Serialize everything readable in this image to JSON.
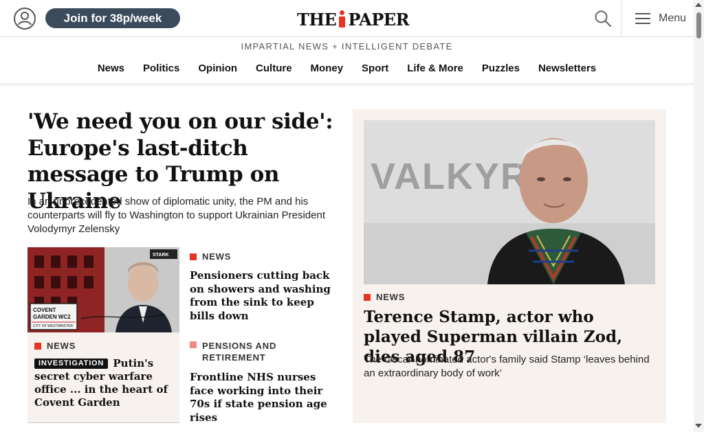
{
  "header": {
    "join_label": "Join for 38p/week",
    "logo_left": "THE",
    "logo_right": "PAPER",
    "menu_label": "Menu",
    "tagline": "IMPARTIAL NEWS + INTELLIGENT DEBATE"
  },
  "nav": [
    "News",
    "Politics",
    "Opinion",
    "Culture",
    "Money",
    "Sport",
    "Life & More",
    "Puzzles",
    "Newsletters"
  ],
  "lead": {
    "headline": "'We need you on our side': Europe's last-ditch message to Trump on Ukraine",
    "standfirst": "In an unprecedented show of diplomatic unity, the PM and his counterparts will fly to Washington to support Ukrainian President Volodymyr Zelensky"
  },
  "card_putin": {
    "tag": "NEWS",
    "badge": "INVESTIGATION",
    "headline": "Putin's secret cyber warfare office ... in the heart of Covent Garden",
    "image_sign_line1": "COVENT",
    "image_sign_line2": "GARDEN WC2",
    "image_sign_line3": "CITY OF WESTMINSTER",
    "image_logo": "STARK"
  },
  "story_a": {
    "tag": "NEWS",
    "headline": "Pensioners cutting back on showers and washing from the sink to keep bills down"
  },
  "story_b": {
    "tag": "PENSIONS AND RETIREMENT",
    "headline": "Frontline NHS nurses face working into their 70s if state pension age rises"
  },
  "feature": {
    "tag": "NEWS",
    "headline": "Terence Stamp, actor who played Superman villain Zod, dies aged 87",
    "standfirst": "The Oscar-nominated actor's family said Stamp ‘leaves behind an extraordinary body of work’",
    "image_backdrop_text": "VALKYRI"
  },
  "colors": {
    "accent_red": "#e63323",
    "pink_tag": "#f08a85",
    "join_button": "#3b4b5c",
    "card_bg": "#f7f2ee"
  },
  "icons": [
    "account-icon",
    "search-icon",
    "menu-icon"
  ]
}
